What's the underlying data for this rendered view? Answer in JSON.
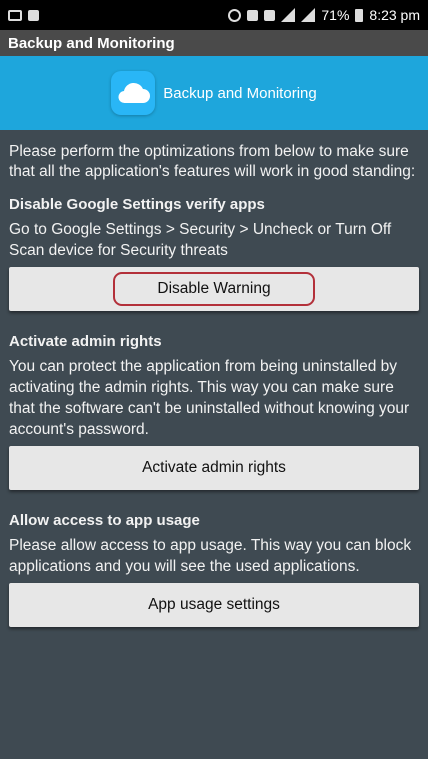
{
  "status_bar": {
    "battery": "71%",
    "time": "8:23 pm"
  },
  "title_bar": {
    "title": "Backup and Monitoring"
  },
  "banner": {
    "title": "Backup and Monitoring",
    "icon": "cloud-icon"
  },
  "intro_text": "Please perform the optimizations from below to make sure that all the application's features will work in good standing:",
  "sections": [
    {
      "title": "Disable Google Settings verify apps",
      "text": "Go to Google Settings > Security > Uncheck or Turn Off Scan device for Security threats",
      "button": "Disable Warning"
    },
    {
      "title": "Activate admin rights",
      "text": "You can protect the application from being uninstalled by activating the admin rights. This way you can make sure that the software can't be uninstalled without knowing your account's password.",
      "button": "Activate admin rights"
    },
    {
      "title": "Allow access to app usage",
      "text": "Please allow access to app usage. This way you can block applications and you will see the used applications.",
      "button": "App usage settings"
    }
  ],
  "colors": {
    "background": "#3f4a52",
    "banner": "#1ea6dc",
    "button": "#e7e7e7",
    "highlight_outline": "#b3303a"
  }
}
